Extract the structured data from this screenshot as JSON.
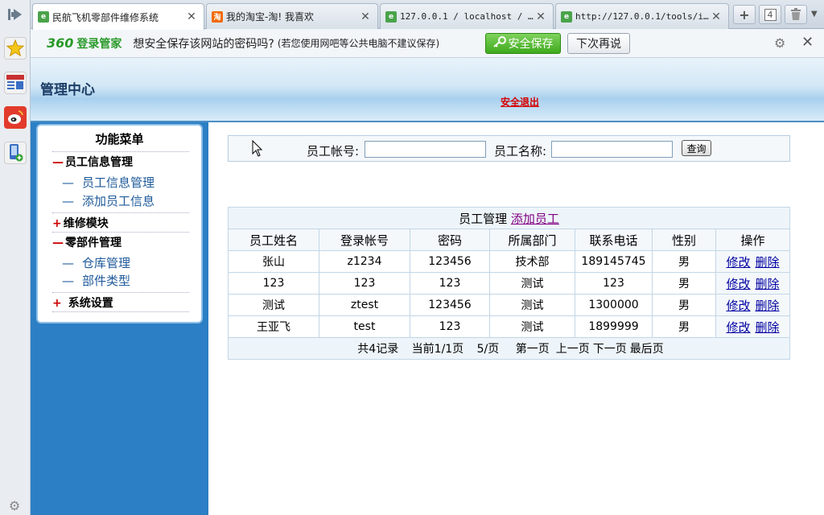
{
  "browser": {
    "tabs": [
      {
        "title": "民航飞机零部件维修系统",
        "icon": "ie-page-icon"
      },
      {
        "title": "我的淘宝-淘! 我喜欢",
        "icon": "taobao-icon"
      },
      {
        "title": "127.0.0.1 / localhost / ...",
        "icon": "ie-page-icon"
      },
      {
        "title": "http://127.0.0.1/tools/i...",
        "icon": "ie-page-icon"
      }
    ],
    "tab_count": "4"
  },
  "password_bar": {
    "brand_num": "360",
    "brand_text": "登录管家",
    "message": "想安全保存该网站的密码吗?",
    "note": "(若您使用网吧等公共电脑不建议保存)",
    "save_label": "安全保存",
    "later_label": "下次再说"
  },
  "header": {
    "title": "管理中心",
    "logout": "安全退出"
  },
  "menu": {
    "title": "功能菜单",
    "groups": [
      {
        "sign": "—",
        "label": "员工信息管理"
      },
      {
        "sign": "+",
        "label": "维修模块"
      },
      {
        "sign": "—",
        "label": "零部件管理"
      },
      {
        "sign": "+",
        "label": "系统设置"
      }
    ],
    "items": {
      "employee_manage": "员工信息管理",
      "employee_add": "添加员工信息",
      "warehouse": "仓库管理",
      "part_types": "部件类型"
    },
    "dash": "—"
  },
  "search": {
    "account_label": "员工帐号:",
    "account_value": "",
    "name_label": "员工名称:",
    "name_value": "",
    "query_label": "查询"
  },
  "table": {
    "caption": "员工管理",
    "add_link": "添加员工",
    "headers": [
      "员工姓名",
      "登录帐号",
      "密码",
      "所属部门",
      "联系电话",
      "性别",
      "操作"
    ],
    "rows": [
      [
        "张山",
        "z1234",
        "123456",
        "技术部",
        "189145745",
        "男"
      ],
      [
        "123",
        "123",
        "123",
        "测试",
        "123",
        "男"
      ],
      [
        "测试",
        "ztest",
        "123456",
        "测试",
        "1300000",
        "男"
      ],
      [
        "王亚飞",
        "test",
        "123",
        "测试",
        "1899999",
        "男"
      ]
    ],
    "edit_label": "修改",
    "delete_label": "删除",
    "footer": {
      "total": "共4记录",
      "current": "当前1/1页",
      "per_page": "5/页",
      "first": "第一页",
      "prev": "上一页",
      "next": "下一页",
      "last": "最后页"
    }
  }
}
